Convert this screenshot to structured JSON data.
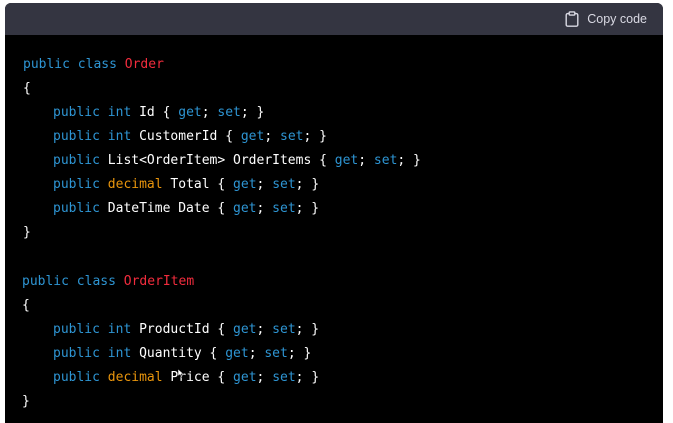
{
  "header": {
    "copy_label": "Copy code",
    "copy_icon": "clipboard-icon",
    "bg": "#343541"
  },
  "colors": {
    "keyword": "#2e95d3",
    "class_name": "#f22c3d",
    "decimal": "#e9950c",
    "text": "#ffffff",
    "background": "#000000"
  },
  "code": {
    "l1": [
      "public",
      " ",
      "class",
      " ",
      "Order"
    ],
    "l2": "{",
    "l3": [
      "public",
      " ",
      "int",
      " Id { ",
      "get",
      "; ",
      "set",
      "; }"
    ],
    "l4": [
      "public",
      " ",
      "int",
      " CustomerId { ",
      "get",
      "; ",
      "set",
      "; }"
    ],
    "l5": [
      "public",
      " List<OrderItem> OrderItems { ",
      "get",
      "; ",
      "set",
      "; }"
    ],
    "l6": [
      "public",
      " ",
      "decimal",
      " Total { ",
      "get",
      "; ",
      "set",
      "; }"
    ],
    "l7": [
      "public",
      " DateTime Date { ",
      "get",
      "; ",
      "set",
      "; }"
    ],
    "l8": "}",
    "l9": [
      "public",
      " ",
      "class",
      " ",
      "OrderItem"
    ],
    "l10": "{",
    "l11": [
      "public",
      " ",
      "int",
      " ProductId { ",
      "get",
      "; ",
      "set",
      "; }"
    ],
    "l12": [
      "public",
      " ",
      "int",
      " Quantity { ",
      "get",
      "; ",
      "set",
      "; }"
    ],
    "l13": [
      "public",
      " ",
      "decimal",
      " Price { ",
      "get",
      "; ",
      "set",
      "; }"
    ],
    "l14": "}"
  }
}
